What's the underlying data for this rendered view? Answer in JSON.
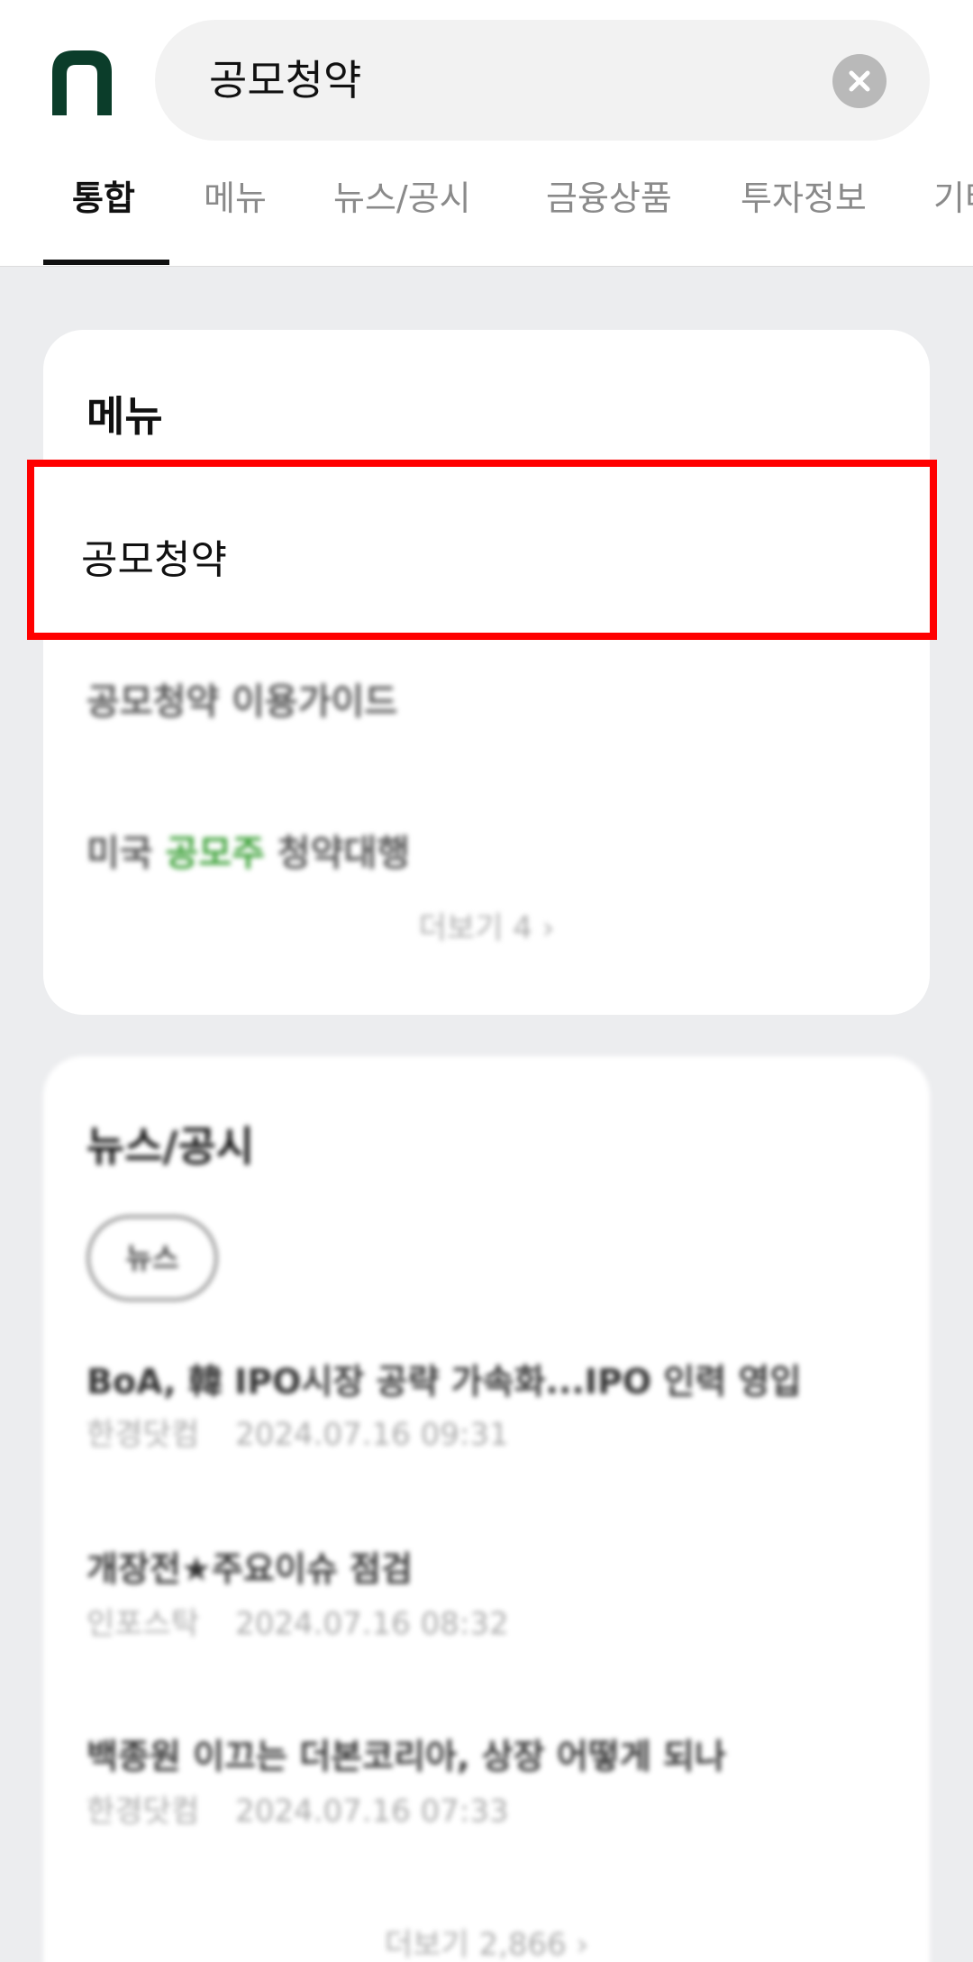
{
  "search": {
    "query": "공모청약"
  },
  "tabs": [
    {
      "label": "통합",
      "active": true
    },
    {
      "label": "메뉴",
      "active": false
    },
    {
      "label": "뉴스/공시",
      "active": false
    },
    {
      "label": "금융상품",
      "active": false
    },
    {
      "label": "투자정보",
      "active": false
    },
    {
      "label": "기타",
      "active": false
    }
  ],
  "menu_section": {
    "title": "메뉴",
    "items": [
      {
        "label": "공모청약"
      },
      {
        "label": "공모청약 이용가이드"
      },
      {
        "prefix": "미국 ",
        "highlight": "공모주",
        "suffix": " 청약대행"
      }
    ],
    "more": "더보기 4",
    "more_arrow": "›"
  },
  "news_section": {
    "title": "뉴스/공시",
    "filter_pill": "뉴스",
    "items": [
      {
        "title": "BoA, 韓 IPO시장 공략 가속화...IPO 인력 영입",
        "source": "한경닷컴",
        "date": "2024.07.16 09:31"
      },
      {
        "title": "개장전★주요이슈 점검",
        "source": "인포스탁",
        "date": "2024.07.16 08:32"
      },
      {
        "title": "백종원 이끄는 더본코리아, 상장 어떻게 되나",
        "source": "한경닷컴",
        "date": "2024.07.16 07:33"
      }
    ],
    "more": "더보기 2,866",
    "more_arrow": "›"
  },
  "colors": {
    "brand": "#0b3d2a",
    "highlight_border": "#ff0000",
    "keyword": "#3aa036"
  },
  "icons": {
    "logo": "brand-logo-icon",
    "clear": "close-icon"
  }
}
